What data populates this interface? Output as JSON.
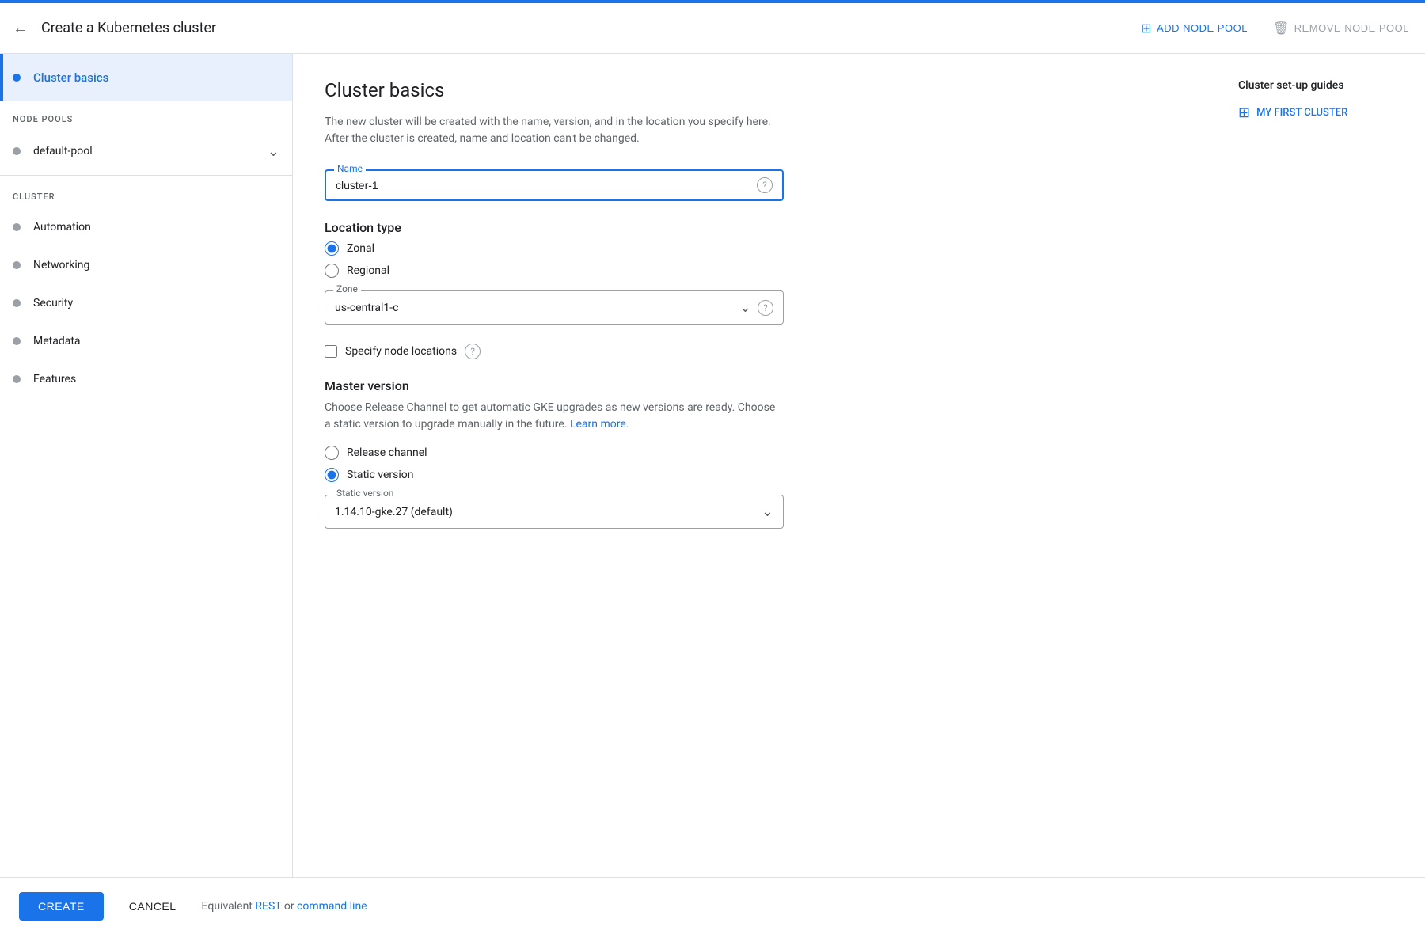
{
  "accent_color": "#1a73e8",
  "top_bar": {
    "back_label": "←",
    "title": "Create a Kubernetes cluster",
    "add_node_pool_label": "ADD NODE POOL",
    "remove_node_pool_label": "REMOVE NODE POOL"
  },
  "sidebar": {
    "cluster_basics_label": "Cluster basics",
    "node_pools_section_label": "NODE POOLS",
    "default_pool_label": "default-pool",
    "cluster_section_label": "CLUSTER",
    "cluster_items": [
      {
        "label": "Automation"
      },
      {
        "label": "Networking"
      },
      {
        "label": "Security"
      },
      {
        "label": "Metadata"
      },
      {
        "label": "Features"
      }
    ]
  },
  "main": {
    "page_title": "Cluster basics",
    "page_description": "The new cluster will be created with the name, version, and in the location you specify here. After the cluster is created, name and location can't be changed.",
    "name_label": "Name",
    "name_value": "cluster-1",
    "location_type_label": "Location type",
    "location_zonal_label": "Zonal",
    "location_regional_label": "Regional",
    "zone_label": "Zone",
    "zone_value": "us-central1-c",
    "specify_node_locations_label": "Specify node locations",
    "master_version_title": "Master version",
    "master_version_desc": "Choose Release Channel to get automatic GKE upgrades as new versions are ready. Choose a static version to upgrade manually in the future.",
    "learn_more_label": "Learn more",
    "release_channel_label": "Release channel",
    "static_version_label": "Static version",
    "static_version_dropdown_label": "Static version",
    "static_version_value": "1.14.10-gke.27 (default)"
  },
  "right_sidebar": {
    "guides_title": "Cluster set-up guides",
    "my_first_cluster_label": "MY FIRST CLUSTER"
  },
  "bottom_bar": {
    "create_label": "CREATE",
    "cancel_label": "CANCEL",
    "equivalent_text": "Equivalent",
    "rest_label": "REST",
    "or_label": "or",
    "command_line_label": "command line"
  }
}
